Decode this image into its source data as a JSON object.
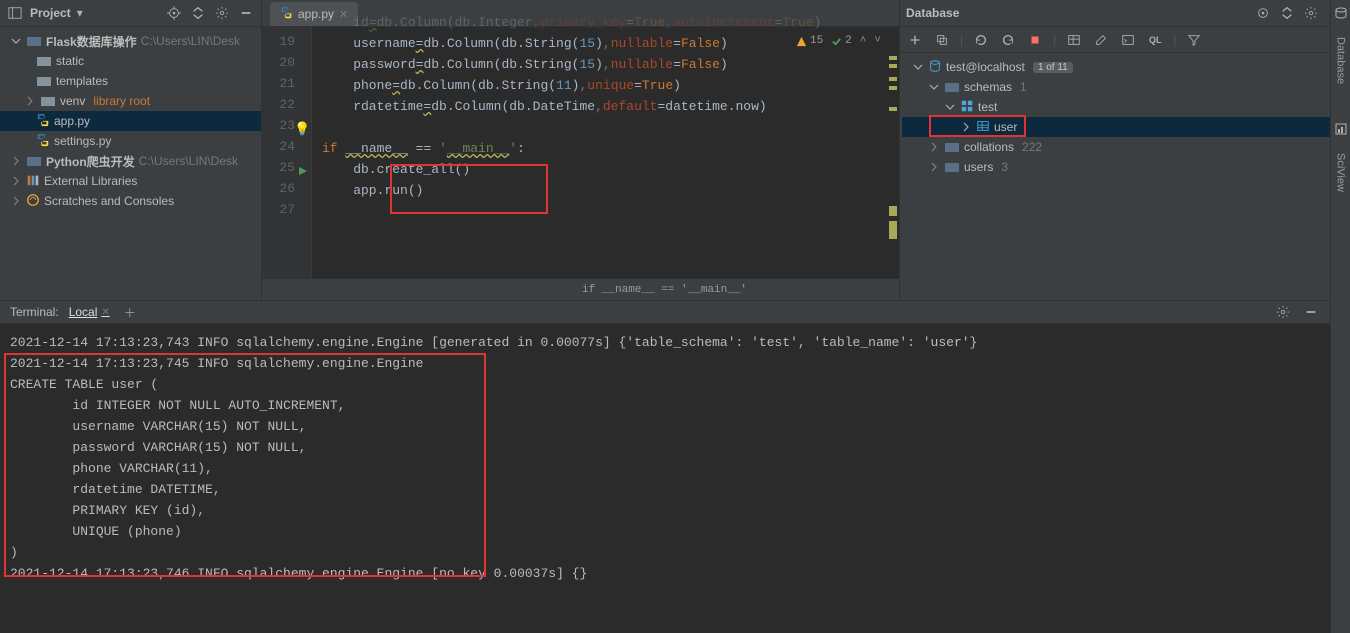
{
  "project": {
    "panel_title": "Project",
    "root_name": "Flask数据库操作",
    "root_path": " C:\\Users\\LIN\\Desk",
    "static": "static",
    "templates": "templates",
    "venv": "venv",
    "venv_hint": "library root",
    "app_file": "app.py",
    "settings_file": "settings.py",
    "second_project": "Python爬虫开发",
    "second_project_path": " C:\\Users\\LIN\\Desk",
    "ext_libs": "External Libraries",
    "scratches": "Scratches and Consoles"
  },
  "editor": {
    "tab_name": "app.py",
    "warnings": "15",
    "check": "2",
    "lines": {
      "n18": "",
      "n19": "        id=db.Column(db.Integer,primary_key=True,autoincrement=True)",
      "n20": "        username=db.Column(db.String(15),nullable=False)",
      "n21": "        password=db.Column(db.String(15),nullable=False)",
      "n22": "        phone=db.Column(db.String(11),unique=True)",
      "n23": "        rdatetime=db.Column(db.DateTime,default=datetime.now)",
      "n24": "",
      "n25_pre": "if __name__ == '",
      "n25_str": "__main__",
      "n25_post": "':",
      "n26": "    db.create_all()",
      "n27": "    app.run()"
    },
    "breadcrumb": "if __name__ == '__main__'"
  },
  "database": {
    "panel_title": "Database",
    "source": "test@localhost",
    "source_badge": "1 of 11",
    "schemas": "schemas",
    "schemas_count": "1",
    "schema_test": "test",
    "table_user": "user",
    "collations": "collations",
    "collations_count": "222",
    "users": "users",
    "users_count": "3"
  },
  "terminal": {
    "label": "Terminal:",
    "tab_local": "Local",
    "lines": [
      "2021-12-14 17:13:23,743 INFO sqlalchemy.engine.Engine [generated in 0.00077s] {'table_schema': 'test', 'table_name': 'user'}",
      "2021-12-14 17:13:23,745 INFO sqlalchemy.engine.Engine ",
      "CREATE TABLE user (",
      "        id INTEGER NOT NULL AUTO_INCREMENT, ",
      "        username VARCHAR(15) NOT NULL, ",
      "        password VARCHAR(15) NOT NULL, ",
      "        phone VARCHAR(11), ",
      "        rdatetime DATETIME, ",
      "        PRIMARY KEY (id), ",
      "        UNIQUE (phone)",
      ")",
      "",
      "",
      "2021-12-14 17:13:23,746 INFO sqlalchemy.engine.Engine [no key 0.00037s] {}"
    ]
  },
  "rail": {
    "db": "Database",
    "sci": "SciView"
  }
}
